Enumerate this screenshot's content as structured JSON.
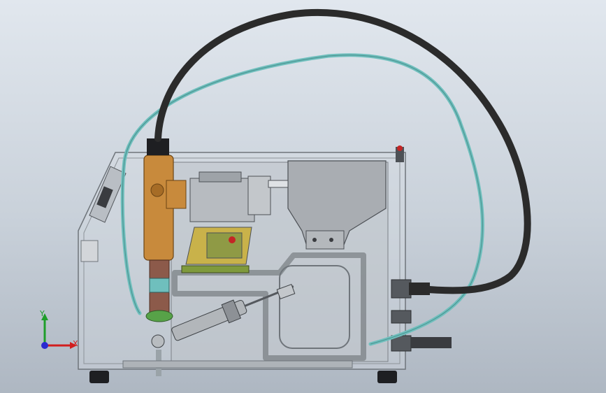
{
  "viewport": {
    "background_top": "#e1e7ee",
    "background_bottom": "#aeb7c2"
  },
  "triad": {
    "x_label": "X",
    "y_label": "Y",
    "x_color": "#d21e1e",
    "y_color": "#1e9e2a",
    "z_color": "#2a2ad0"
  },
  "colors": {
    "black_cable": "#2b2b2b",
    "teal_hose": "#6fbfbd",
    "brass_body": "#c88a3c",
    "housing_line": "#6f757b",
    "green_plate": "#7f9a3c"
  }
}
